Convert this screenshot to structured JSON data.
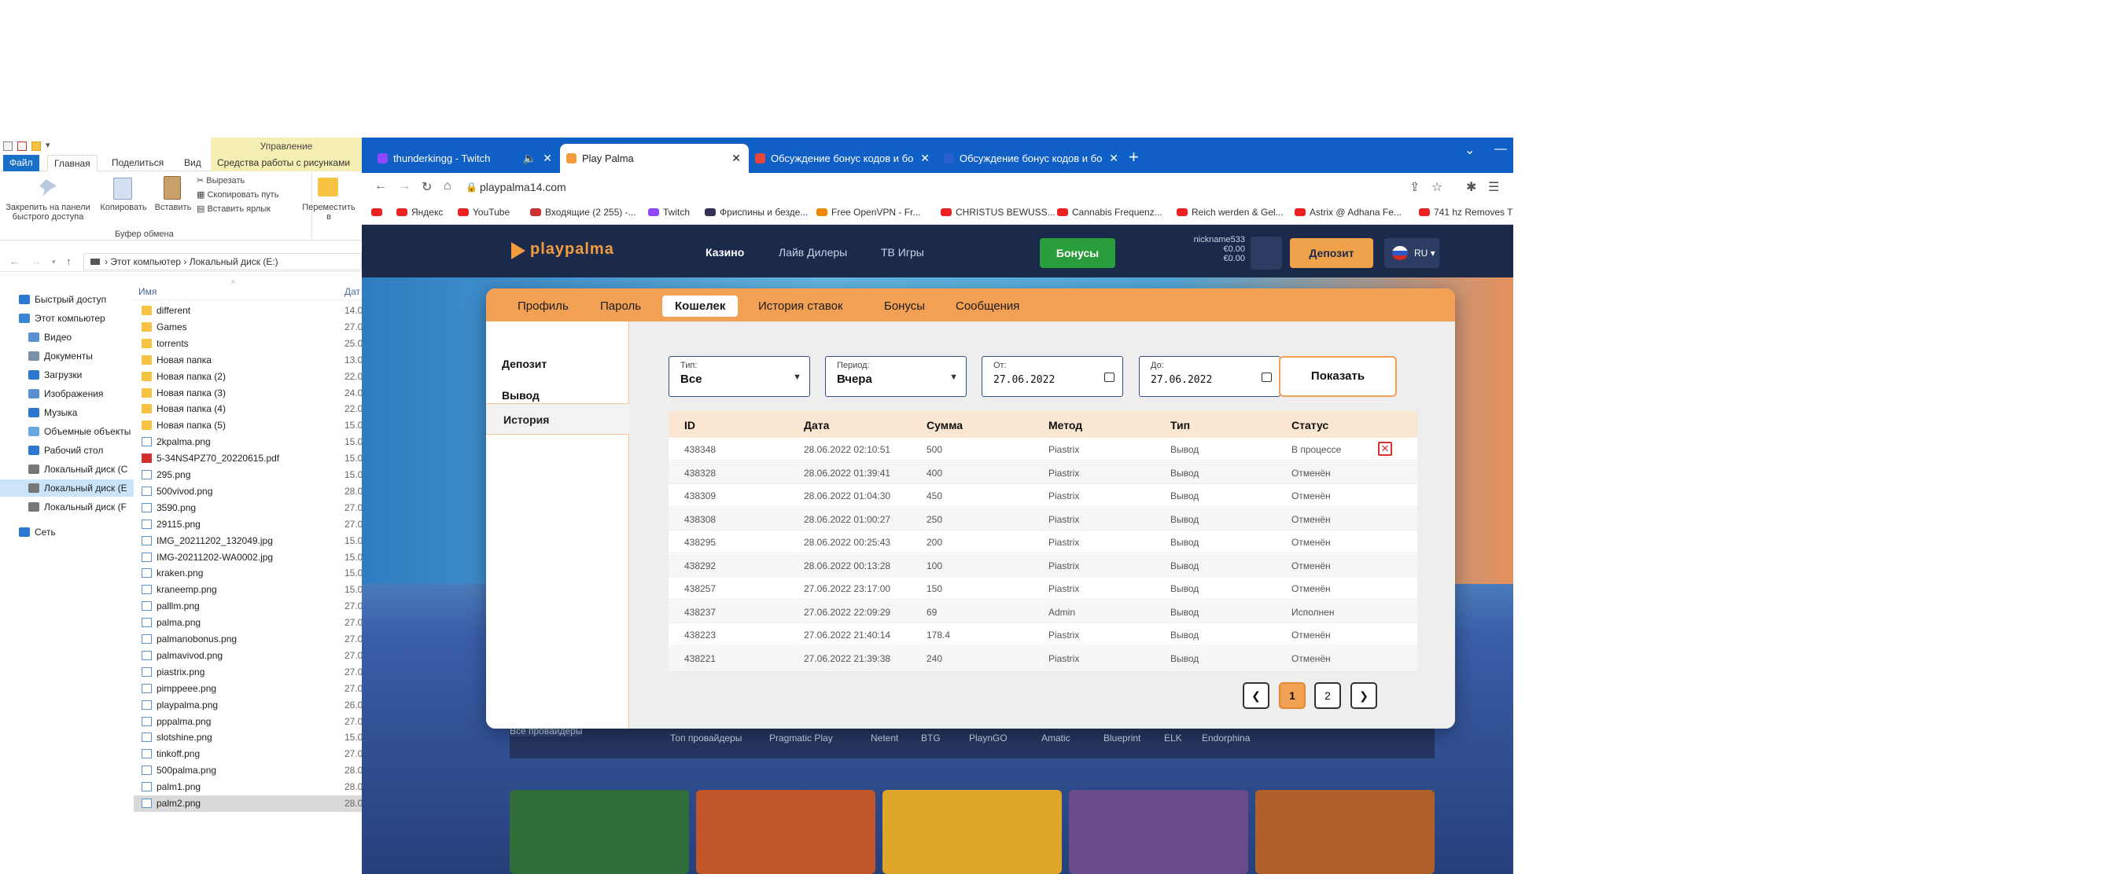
{
  "explorer": {
    "manage_tab": "Управление",
    "tabs": [
      "Файл",
      "Главная",
      "Поделиться",
      "Вид",
      "Средства работы с рисунками"
    ],
    "ribbon": {
      "pin": "Закрепить на панели быстрого доступа",
      "copy": "Копировать",
      "paste": "Вставить",
      "cut": "Вырезать",
      "copy_path": "Скопировать путь",
      "paste_shortcut": "Вставить ярлык",
      "move_to": "Переместить в",
      "group_label": "Буфер обмена"
    },
    "address": [
      "Этот компьютер",
      "Локальный диск (E:)"
    ],
    "column_name": "Имя",
    "column_date": "Дат",
    "nav": [
      {
        "label": "Быстрый доступ",
        "color": "#2b78d0"
      },
      {
        "label": "Этот компьютер",
        "color": "#3a86d4"
      },
      {
        "label": "Видео",
        "color": "#5a8fd0"
      },
      {
        "label": "Документы",
        "color": "#7a8fa8"
      },
      {
        "label": "Загрузки",
        "color": "#2b78d0"
      },
      {
        "label": "Изображения",
        "color": "#5a8fd0"
      },
      {
        "label": "Музыка",
        "color": "#2b78d0"
      },
      {
        "label": "Объемные объекты",
        "color": "#6aa6e0"
      },
      {
        "label": "Рабочий стол",
        "color": "#2b78d0"
      },
      {
        "label": "Локальный диск (C",
        "color": "#777"
      },
      {
        "label": "Локальный диск (E",
        "color": "#777"
      },
      {
        "label": "Локальный диск (F",
        "color": "#777"
      },
      {
        "label": "Сеть",
        "color": "#2b78d0"
      }
    ],
    "files": [
      {
        "name": "different",
        "type": "folder",
        "date": "14.0"
      },
      {
        "name": "Games",
        "type": "folder",
        "date": "27.0"
      },
      {
        "name": "torrents",
        "type": "folder",
        "date": "25.0"
      },
      {
        "name": "Новая папка",
        "type": "folder",
        "date": "13.0"
      },
      {
        "name": "Новая папка (2)",
        "type": "folder",
        "date": "22.0"
      },
      {
        "name": "Новая папка (3)",
        "type": "folder",
        "date": "24.0"
      },
      {
        "name": "Новая папка (4)",
        "type": "folder",
        "date": "22.0"
      },
      {
        "name": "Новая папка (5)",
        "type": "folder",
        "date": "15.0"
      },
      {
        "name": "2kpalma.png",
        "type": "png",
        "date": "15.0"
      },
      {
        "name": "5-34NS4PZ70_20220615.pdf",
        "type": "pdf",
        "date": "15.0"
      },
      {
        "name": "295.png",
        "type": "png",
        "date": "15.0"
      },
      {
        "name": "500vivod.png",
        "type": "png",
        "date": "28.0"
      },
      {
        "name": "3590.png",
        "type": "png",
        "date": "27.0"
      },
      {
        "name": "29115.png",
        "type": "png",
        "date": "27.0"
      },
      {
        "name": "IMG_20211202_132049.jpg",
        "type": "png",
        "date": "15.0"
      },
      {
        "name": "IMG-20211202-WA0002.jpg",
        "type": "png",
        "date": "15.0"
      },
      {
        "name": "kraken.png",
        "type": "png",
        "date": "15.0"
      },
      {
        "name": "kraneemp.png",
        "type": "png",
        "date": "15.0"
      },
      {
        "name": "palllm.png",
        "type": "png",
        "date": "27.0"
      },
      {
        "name": "palma.png",
        "type": "png",
        "date": "27.0"
      },
      {
        "name": "palmanobonus.png",
        "type": "png",
        "date": "27.0"
      },
      {
        "name": "palmavivod.png",
        "type": "png",
        "date": "27.0"
      },
      {
        "name": "piastrix.png",
        "type": "png",
        "date": "27.0"
      },
      {
        "name": "pimppeee.png",
        "type": "png",
        "date": "27.0"
      },
      {
        "name": "playpalma.png",
        "type": "png",
        "date": "26.0"
      },
      {
        "name": "pppalma.png",
        "type": "png",
        "date": "27.0"
      },
      {
        "name": "slotshine.png",
        "type": "png",
        "date": "15.0"
      },
      {
        "name": "tinkoff.png",
        "type": "png",
        "date": "27.0"
      },
      {
        "name": "500palma.png",
        "type": "png",
        "date": "28.0"
      },
      {
        "name": "palm1.png",
        "type": "png",
        "date": "28.0"
      },
      {
        "name": "palm2.png",
        "type": "png",
        "date": "28.0"
      }
    ]
  },
  "browser": {
    "tabs": [
      {
        "title": "thunderkingg - Twitch",
        "favicon_color": "#9146ff"
      },
      {
        "title": "Play Palma",
        "favicon_color": "#f39c3d"
      },
      {
        "title": "Обсуждение бонус кодов и бо",
        "favicon_color": "#e8453c"
      },
      {
        "title": "Обсуждение бонус кодов и бо",
        "favicon_color": "#2a5fd0"
      }
    ],
    "new_tab": "+",
    "url": "playpalma14.com",
    "bookmarks": [
      {
        "label": "",
        "color": "#e22"
      },
      {
        "label": "Яндекс",
        "color": "#e22"
      },
      {
        "label": "YouTube",
        "color": "#e22"
      },
      {
        "label": "Входящие (2 255) -...",
        "color": "#c33"
      },
      {
        "label": "Twitch",
        "color": "#9146ff"
      },
      {
        "label": "Фриспины и бездe...",
        "color": "#335"
      },
      {
        "label": "Free OpenVPN - Fr...",
        "color": "#e80"
      },
      {
        "label": "CHRISTUS BEWUSS...",
        "color": "#e22"
      },
      {
        "label": "Cannabis Frequenz...",
        "color": "#e22"
      },
      {
        "label": "Reich werden & Gel...",
        "color": "#e22"
      },
      {
        "label": "Astrix @ Adhana Fe...",
        "color": "#e22"
      },
      {
        "label": "741 hz Removes T",
        "color": "#e22"
      }
    ]
  },
  "site": {
    "logo": "playpalma",
    "nav": [
      "Казино",
      "Лайв Дилеры",
      "ТВ Игры"
    ],
    "bonus_button": "Бонусы",
    "account": {
      "user": "nickname533",
      "balance1": "€0.00",
      "balance2": "€0.00"
    },
    "deposit_button": "Депозит",
    "lang": "RU",
    "providers": [
      "Все провайдеры",
      "Топ провайдеры",
      "Pragmatic Play",
      "Netent",
      "BTG",
      "PlaynGO",
      "Amatic",
      "Blueprint",
      "ELK",
      "Endorphina"
    ],
    "game_colors": [
      "#2f6d3a",
      "#c0562a",
      "#e0a52b",
      "#6a4a8a",
      "#b0602a"
    ]
  },
  "modal": {
    "tabs": [
      "Профиль",
      "Пароль",
      "Кошелек",
      "История ставок",
      "Бонусы",
      "Сообщения"
    ],
    "active_tab": "Кошелек",
    "sidebar": [
      "Депозит",
      "Вывод",
      "История"
    ],
    "filters": {
      "type_label": "Тип:",
      "type_value": "Все",
      "period_label": "Период:",
      "period_value": "Вчера",
      "from_label": "От:",
      "from_value": "27.06.2022",
      "to_label": "До:",
      "to_value": "27.06.2022",
      "show_button": "Показать"
    },
    "columns": [
      "ID",
      "Дата",
      "Сумма",
      "Метод",
      "Тип",
      "Статус"
    ],
    "rows": [
      {
        "id": "438348",
        "date": "28.06.2022 02:10:51",
        "amount": "500",
        "method": "Piastrix",
        "type": "Вывод",
        "status": "В процессе",
        "cancel": true
      },
      {
        "id": "438328",
        "date": "28.06.2022 01:39:41",
        "amount": "400",
        "method": "Piastrix",
        "type": "Вывод",
        "status": "Отменён"
      },
      {
        "id": "438309",
        "date": "28.06.2022 01:04:30",
        "amount": "450",
        "method": "Piastrix",
        "type": "Вывод",
        "status": "Отменён"
      },
      {
        "id": "438308",
        "date": "28.06.2022 01:00:27",
        "amount": "250",
        "method": "Piastrix",
        "type": "Вывод",
        "status": "Отменён"
      },
      {
        "id": "438295",
        "date": "28.06.2022 00:25:43",
        "amount": "200",
        "method": "Piastrix",
        "type": "Вывод",
        "status": "Отменён"
      },
      {
        "id": "438292",
        "date": "28.06.2022 00:13:28",
        "amount": "100",
        "method": "Piastrix",
        "type": "Вывод",
        "status": "Отменён"
      },
      {
        "id": "438257",
        "date": "27.06.2022 23:17:00",
        "amount": "150",
        "method": "Piastrix",
        "type": "Вывод",
        "status": "Отменён"
      },
      {
        "id": "438237",
        "date": "27.06.2022 22:09:29",
        "amount": "69",
        "method": "Admin",
        "type": "Вывод",
        "status": "Исполнен"
      },
      {
        "id": "438223",
        "date": "27.06.2022 21:40:14",
        "amount": "178.4",
        "method": "Piastrix",
        "type": "Вывод",
        "status": "Отменён"
      },
      {
        "id": "438221",
        "date": "27.06.2022 21:39:38",
        "amount": "240",
        "method": "Piastrix",
        "type": "Вывод",
        "status": "Отменён"
      }
    ],
    "pages": [
      "1",
      "2"
    ],
    "current_page": "1"
  }
}
